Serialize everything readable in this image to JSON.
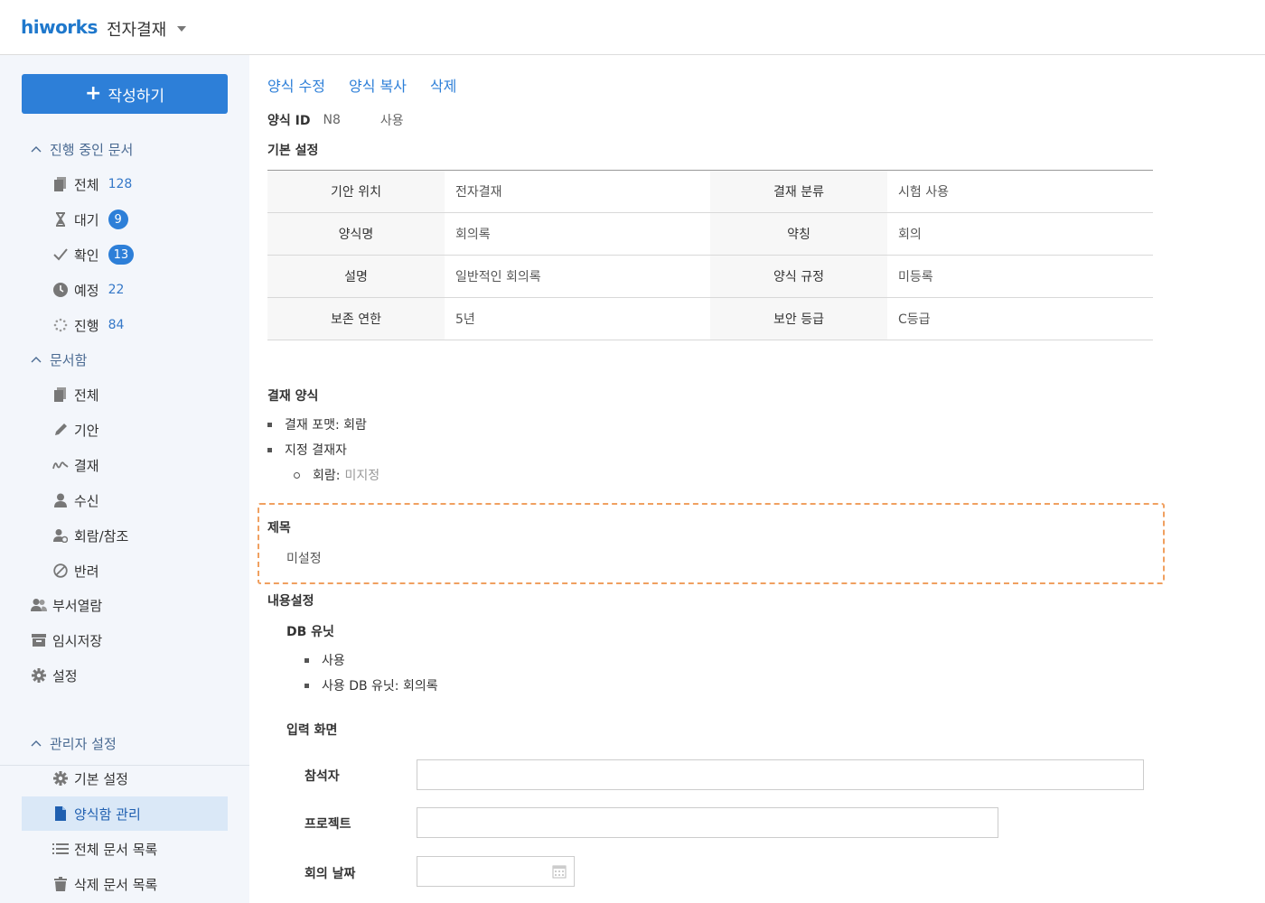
{
  "header": {
    "logo": "hiworks",
    "app_title": "전자결재"
  },
  "sidebar": {
    "compose_label": "작성하기",
    "in_progress": {
      "title": "진행 중인 문서",
      "items": [
        {
          "label": "전체",
          "count": "128",
          "style": "plain"
        },
        {
          "label": "대기",
          "count": "9",
          "style": "badge"
        },
        {
          "label": "확인",
          "count": "13",
          "style": "badge"
        },
        {
          "label": "예정",
          "count": "22",
          "style": "plain"
        },
        {
          "label": "진행",
          "count": "84",
          "style": "plain"
        }
      ]
    },
    "docbox": {
      "title": "문서함",
      "items": [
        {
          "label": "전체"
        },
        {
          "label": "기안"
        },
        {
          "label": "결재"
        },
        {
          "label": "수신"
        },
        {
          "label": "회람/참조"
        },
        {
          "label": "반려"
        }
      ]
    },
    "top_items": [
      {
        "label": "부서열람"
      },
      {
        "label": "임시저장"
      },
      {
        "label": "설정"
      }
    ],
    "admin": {
      "title": "관리자 설정",
      "items": [
        {
          "label": "기본 설정"
        },
        {
          "label": "양식함 관리"
        },
        {
          "label": "전체 문서 목록"
        },
        {
          "label": "삭제 문서 목록"
        }
      ]
    }
  },
  "main": {
    "actions": [
      "양식 수정",
      "양식 복사",
      "삭제"
    ],
    "form_id_label": "양식 ID",
    "form_id_value": "N8",
    "form_status": "사용",
    "basic_settings_title": "기본 설정",
    "table": [
      [
        {
          "k": "기안 위치",
          "v": "전자결재"
        },
        {
          "k": "결재 분류",
          "v": "시험 사용"
        }
      ],
      [
        {
          "k": "양식명",
          "v": "회의록"
        },
        {
          "k": "약칭",
          "v": "회의"
        }
      ],
      [
        {
          "k": "설명",
          "v": "일반적인 회의록"
        },
        {
          "k": "양식 규정",
          "v": "미등록"
        }
      ],
      [
        {
          "k": "보존 연한",
          "v": "5년"
        },
        {
          "k": "보안 등급",
          "v": "C등급"
        }
      ]
    ],
    "approval_form_title": "결재 양식",
    "approval_format": "결재 포맷: 회람",
    "designated_approver": "지정 결재자",
    "circulation_label": "회람:",
    "circulation_value": "미지정",
    "subject_title": "제목",
    "subject_value": "미설정",
    "content_settings_title": "내용설정",
    "db_unit_title": "DB 유닛",
    "db_unit_use": "사용",
    "db_unit_used": "사용 DB 유닛: 회의록",
    "input_screen_title": "입력 화면",
    "fields": [
      {
        "label": "참석자",
        "value": ""
      },
      {
        "label": "프로젝트",
        "value": ""
      },
      {
        "label": "회의 날짜",
        "value": ""
      }
    ]
  }
}
